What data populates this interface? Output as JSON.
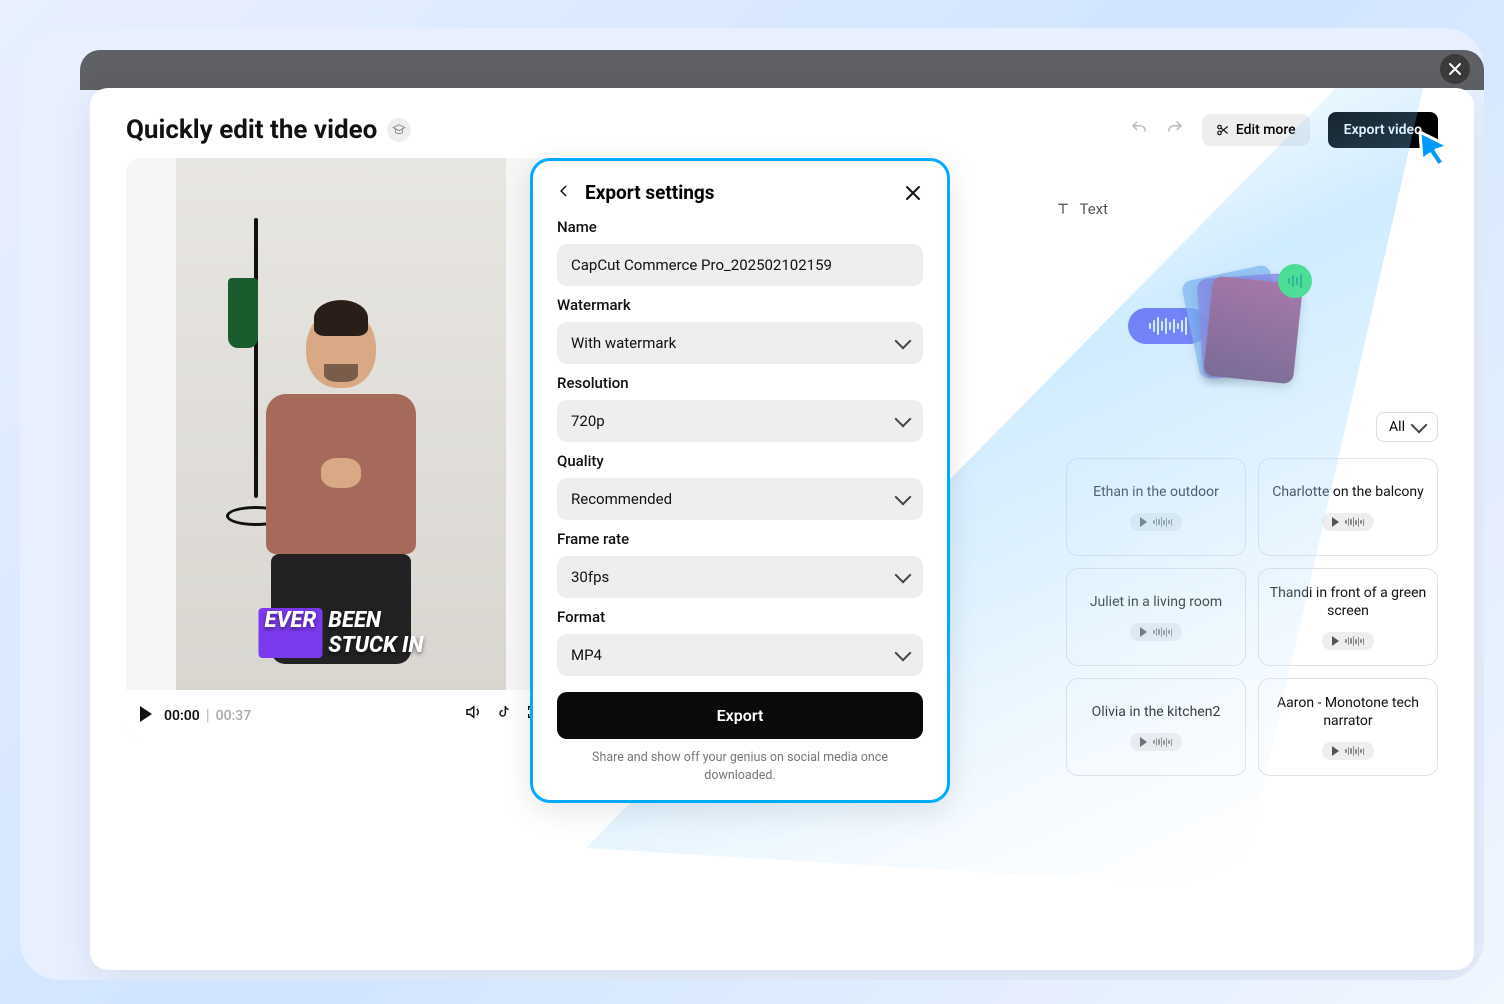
{
  "page": {
    "title": "Quickly edit the video"
  },
  "header": {
    "edit_more": "Edit more",
    "export_video": "Export video"
  },
  "tabs": {
    "text": "Text"
  },
  "player": {
    "current": "00:00",
    "total": "00:37"
  },
  "caption": {
    "w1": "EVER",
    "w2": "BEEN STUCK IN"
  },
  "filter": {
    "all": "All"
  },
  "voices": [
    {
      "name": "Ethan in the outdoor"
    },
    {
      "name": "Charlotte on the balcony"
    },
    {
      "name": "Juliet in a living room"
    },
    {
      "name": "Thandi in front of a green screen"
    },
    {
      "name": "Olivia in the kitchen2"
    },
    {
      "name": "Aaron - Monotone tech narrator"
    }
  ],
  "modal": {
    "title": "Export settings",
    "name_label": "Name",
    "name_value": "CapCut Commerce Pro_202502102159",
    "watermark_label": "Watermark",
    "watermark_value": "With watermark",
    "resolution_label": "Resolution",
    "resolution_value": "720p",
    "quality_label": "Quality",
    "quality_value": "Recommended",
    "framerate_label": "Frame rate",
    "framerate_value": "30fps",
    "format_label": "Format",
    "format_value": "MP4",
    "export_button": "Export",
    "note": "Share and show off your genius on social media once downloaded."
  }
}
